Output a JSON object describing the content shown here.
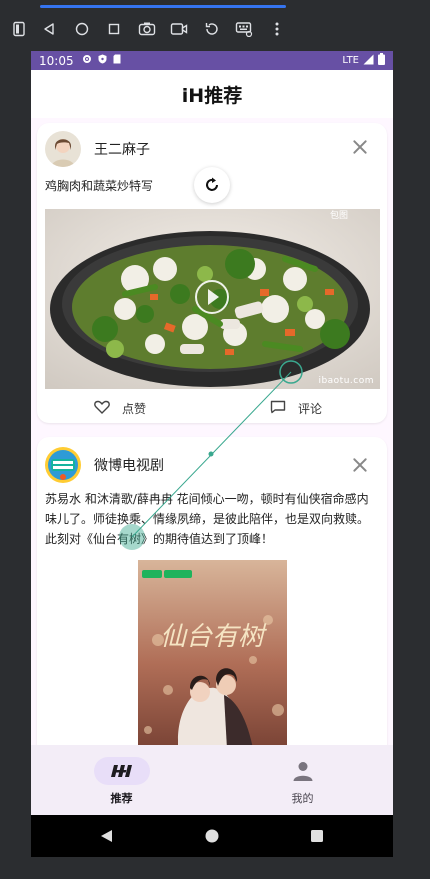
{
  "status_bar": {
    "time": "10:05",
    "network": "LTE"
  },
  "app": {
    "title": "iH推荐"
  },
  "posts": [
    {
      "author": "王二麻子",
      "text": "鸡胸肉和蔬菜炒特写",
      "watermark": "ibaotu.com",
      "like_label": "点赞",
      "comment_label": "评论"
    },
    {
      "author": "微博电视剧",
      "text": "苏易水 和沐清歌/薛冉冉 花间倾心一吻，顿时有仙侠宿命感内味儿了。师徒换乘、情缘夙缔，是彼此陪伴，也是双向救赎。此刻对《仙台有树》的期待值达到了顶峰！",
      "poster_title": "仙台有树"
    }
  ],
  "bottom_nav": {
    "items": [
      {
        "label": "推荐",
        "icon": "ih-logo-icon"
      },
      {
        "label": "我的",
        "icon": "person-icon"
      }
    ]
  },
  "colors": {
    "accent": "#6750a4",
    "nav_bg": "#f3edf7",
    "pill": "#e8def8",
    "feed_bg": "#fef7ff"
  }
}
